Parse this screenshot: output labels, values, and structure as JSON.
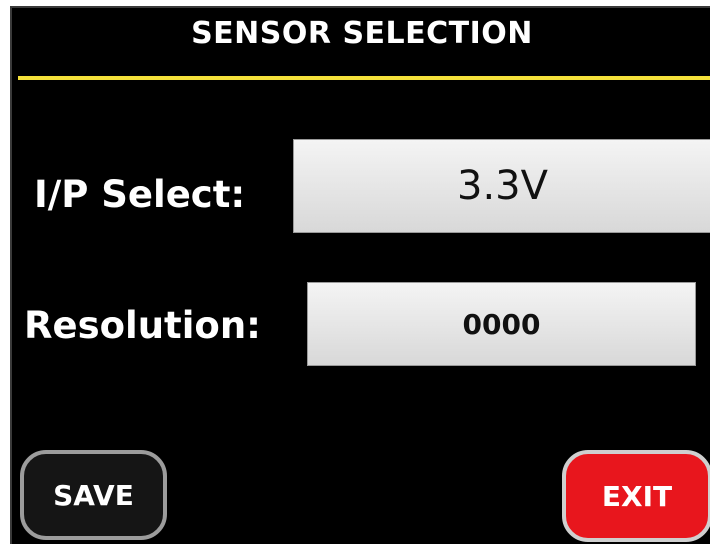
{
  "screen": {
    "title": "SENSOR SELECTION",
    "accent_color": "#f5e13a"
  },
  "fields": {
    "ip_select": {
      "label": "I/P Select:",
      "value": "3.3V"
    },
    "resolution": {
      "label": "Resolution:",
      "value": "0000"
    }
  },
  "buttons": {
    "save_label": "SAVE",
    "exit_label": "EXIT",
    "exit_color": "#e8161d"
  }
}
